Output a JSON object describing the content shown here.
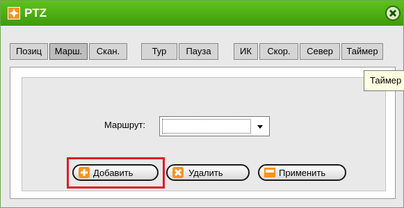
{
  "window": {
    "title": "PTZ"
  },
  "tabs": [
    {
      "label": "Позиц"
    },
    {
      "label": "Марш."
    },
    {
      "label": "Скан."
    },
    {
      "label": "Тур"
    },
    {
      "label": "Пауза"
    },
    {
      "label": "ИК"
    },
    {
      "label": "Скор."
    },
    {
      "label": "Север"
    },
    {
      "label": "Таймер"
    }
  ],
  "active_tab": "Марш.",
  "tooltip": {
    "text": "Таймер"
  },
  "form": {
    "route_label": "Маршрут:",
    "route_value": ""
  },
  "buttons": {
    "add": "Добавить",
    "delete": "Удалить",
    "apply": "Применить"
  },
  "colors": {
    "titlebar": "#4cae14",
    "highlight": "#e31b23",
    "add_icon": "#f7941d",
    "delete_icon": "#f7941d",
    "apply_icon": "#f7941d"
  }
}
